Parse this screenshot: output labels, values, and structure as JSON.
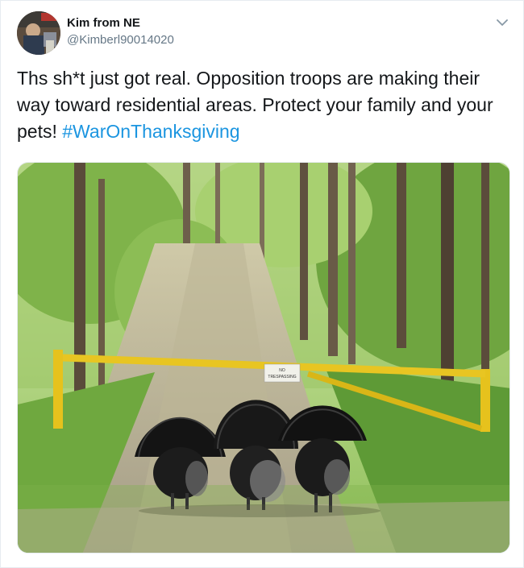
{
  "tweet": {
    "author_name": "Kim from NE",
    "author_handle": "@Kimberl90014020",
    "text": "Ths sh*t just got real.  Opposition troops are making their way toward residential areas.  Protect your family and your pets! ",
    "hashtag": "#WarOnThanksgiving"
  },
  "media": {
    "sign_text_1": "NO",
    "sign_text_2": "TRESPASSING"
  },
  "icons": {
    "more": "chevron-down-icon"
  },
  "colors": {
    "link": "#1b95e0",
    "secondary_text": "#657786",
    "primary_text": "#14171a",
    "gate_yellow": "#e6c21d"
  }
}
